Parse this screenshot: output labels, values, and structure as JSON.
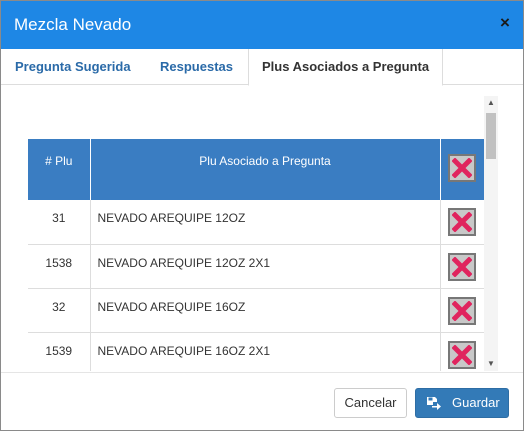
{
  "window": {
    "title": "Mezcla Nevado",
    "close_glyph": "×"
  },
  "tabs": [
    {
      "label": "Pregunta Sugerida",
      "active": false
    },
    {
      "label": "Respuestas",
      "active": false
    },
    {
      "label": "Plus Asociados a Pregunta",
      "active": true
    }
  ],
  "table": {
    "headers": {
      "num": "# Plu",
      "name": "Plu Asociado a Pregunta"
    },
    "rows": [
      {
        "num": "31",
        "name": "NEVADO AREQUIPE 12OZ"
      },
      {
        "num": "1538",
        "name": "NEVADO AREQUIPE 12OZ 2X1"
      },
      {
        "num": "32",
        "name": "NEVADO AREQUIPE 16OZ"
      },
      {
        "num": "1539",
        "name": "NEVADO AREQUIPE 16OZ 2X1"
      }
    ]
  },
  "scrollbar": {
    "up_glyph": "▲",
    "down_glyph": "▼"
  },
  "footer": {
    "cancel_label": "Cancelar",
    "save_label": "Guardar"
  },
  "colors": {
    "header": "#1e87e5",
    "table_header": "#3a7dc2",
    "delete_x": "#e0245e",
    "primary_button": "#337ab7"
  },
  "icons": {
    "close": "close-icon",
    "delete": "x-mark-icon",
    "save": "save-icon"
  }
}
